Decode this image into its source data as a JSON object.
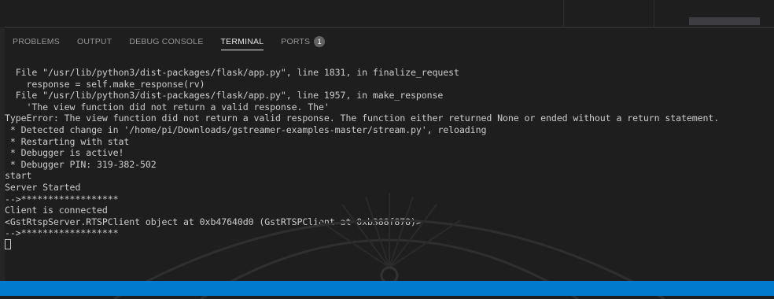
{
  "panel": {
    "tabs": [
      {
        "label": "PROBLEMS",
        "active": false
      },
      {
        "label": "OUTPUT",
        "active": false
      },
      {
        "label": "DEBUG CONSOLE",
        "active": false
      },
      {
        "label": "TERMINAL",
        "active": true
      },
      {
        "label": "PORTS",
        "active": false,
        "badge": "1"
      }
    ]
  },
  "terminal": {
    "lines": [
      "  File \"/usr/lib/python3/dist-packages/flask/app.py\", line 1831, in finalize_request",
      "    response = self.make_response(rv)",
      "  File \"/usr/lib/python3/dist-packages/flask/app.py\", line 1957, in make_response",
      "    'The view function did not return a valid response. The'",
      "TypeError: The view function did not return a valid response. The function either returned None or ended without a return statement.",
      " * Detected change in '/home/pi/Downloads/gstreamer-examples-master/stream.py', reloading",
      " * Restarting with stat",
      " * Debugger is active!",
      " * Debugger PIN: 319-382-502",
      "start",
      "Server Started",
      "-->******************",
      "Client is connected",
      "<GstRtspServer.RTSPClient object at 0xb47640d0 (GstRTSPClient at 0xb388f878)>",
      "-->******************"
    ]
  },
  "colors": {
    "background": "#1e1e1e",
    "terminal_text": "#cccccc",
    "statusbar": "#007acc",
    "tab_inactive": "#969696",
    "tab_active": "#e7e7e7"
  }
}
